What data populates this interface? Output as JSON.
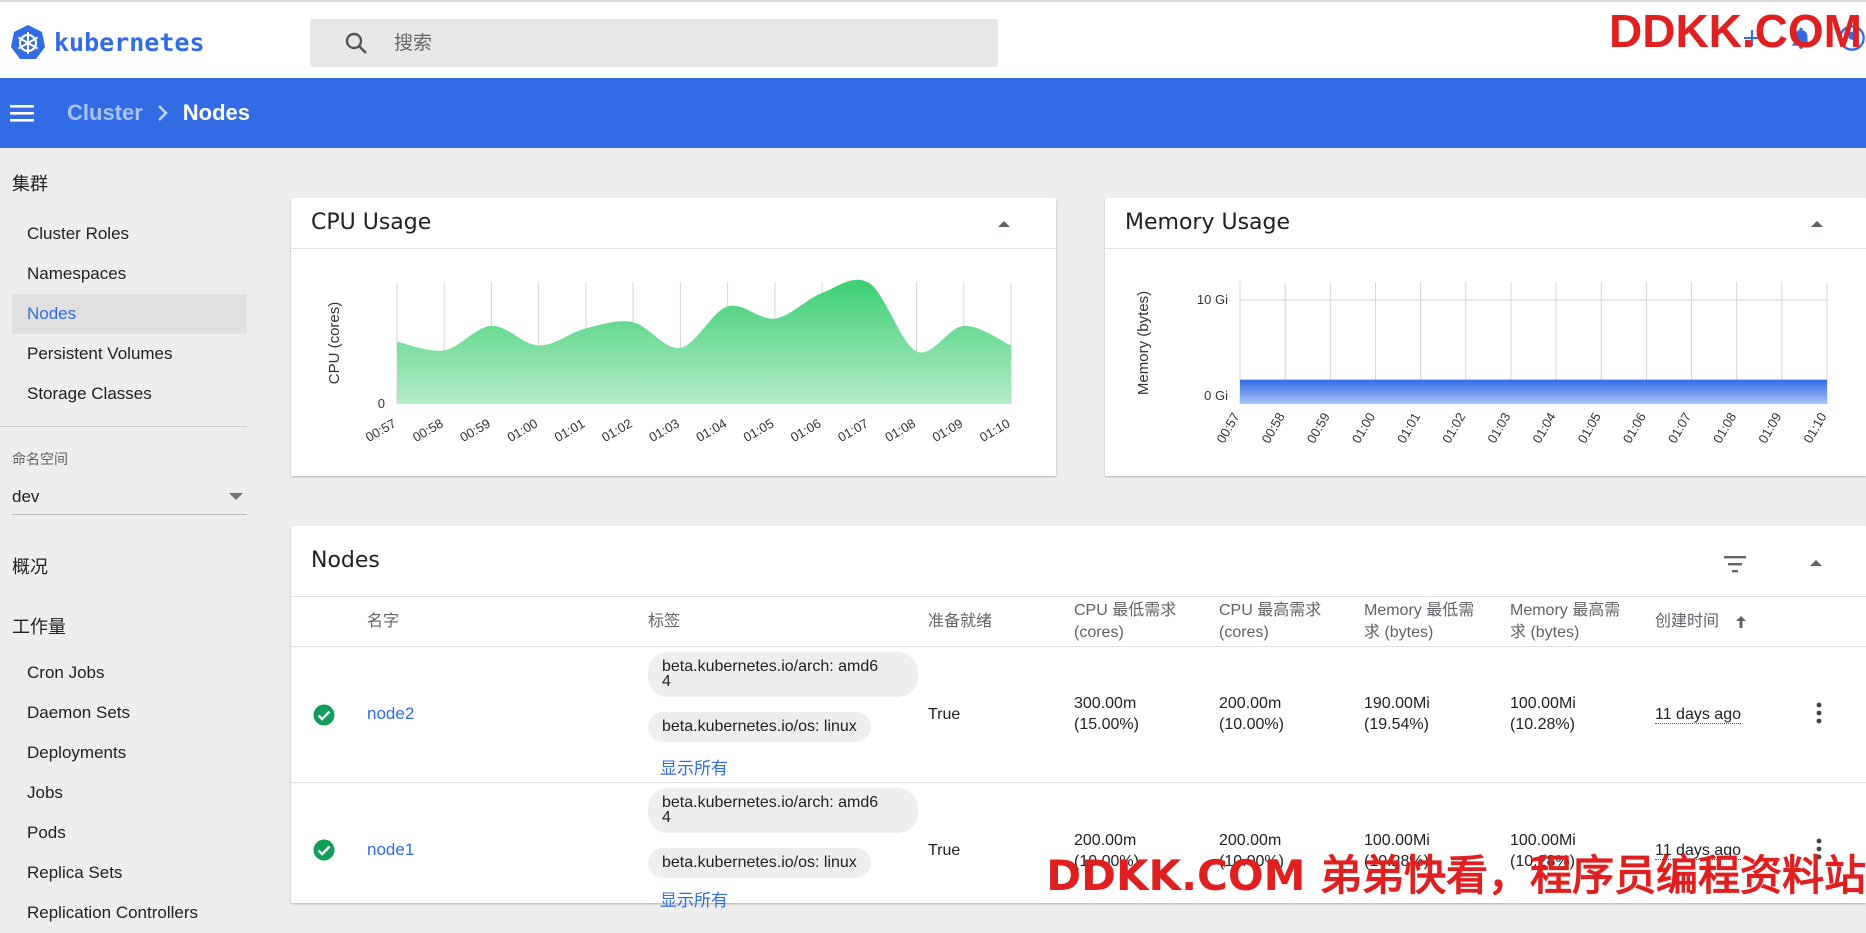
{
  "app": {
    "logo_text": "kubernetes"
  },
  "search": {
    "placeholder": "搜索"
  },
  "watermark": {
    "top": "DDKK.COM",
    "bottom": "DDKK.COM 弟弟快看，程序员编程资料站"
  },
  "breadcrumb": {
    "parent": "Cluster",
    "current": "Nodes"
  },
  "sidebar": {
    "cluster_heading": "集群",
    "cluster_items": [
      "Cluster Roles",
      "Namespaces",
      "Nodes",
      "Persistent Volumes",
      "Storage Classes"
    ],
    "namespace_label": "命名空间",
    "namespace_value": "dev",
    "overview_heading": "概况",
    "workloads_heading": "工作量",
    "workload_items": [
      "Cron Jobs",
      "Daemon Sets",
      "Deployments",
      "Jobs",
      "Pods",
      "Replica Sets",
      "Replication Controllers"
    ]
  },
  "colors": {
    "brand": "#326ce5",
    "cpu_fill": "#3ccf73",
    "mem_fill": "#326ce5",
    "ready": "#0f9d58"
  },
  "cpu_card": {
    "title": "CPU Usage"
  },
  "mem_card": {
    "title": "Memory Usage"
  },
  "chart_data": [
    {
      "type": "area",
      "title": "CPU Usage",
      "ylabel": "CPU (cores)",
      "xlabel": "",
      "y_ticks": [
        "0"
      ],
      "x": [
        "00:57",
        "00:58",
        "00:59",
        "01:00",
        "01:01",
        "01:02",
        "01:03",
        "01:04",
        "01:05",
        "01:06",
        "01:07",
        "01:08",
        "01:09",
        "01:10"
      ],
      "series": [
        {
          "values": [
            0.51,
            0.44,
            0.64,
            0.48,
            0.62,
            0.67,
            0.46,
            0.8,
            0.7,
            0.91,
            0.99,
            0.43,
            0.64,
            0.48
          ]
        }
      ],
      "ylim": [
        0,
        1
      ]
    },
    {
      "type": "area",
      "title": "Memory Usage",
      "ylabel": "Memory (bytes)",
      "xlabel": "",
      "y_ticks": [
        "10 Gi",
        "0 Gi"
      ],
      "x": [
        "00:57",
        "00:58",
        "00:59",
        "01:00",
        "01:01",
        "01:02",
        "01:03",
        "01:04",
        "01:05",
        "01:06",
        "01:07",
        "01:08",
        "01:09",
        "01:10"
      ],
      "series": [
        {
          "values": [
            2.0,
            2.0,
            2.0,
            2.0,
            2.0,
            2.0,
            2.0,
            2.0,
            2.0,
            2.0,
            2.0,
            2.0,
            2.0,
            2.0
          ]
        }
      ],
      "ylim": [
        0,
        10
      ]
    }
  ],
  "nodes": {
    "title": "Nodes",
    "headers": {
      "name": "名字",
      "labels": "标签",
      "ready": "准备就绪",
      "cpu_req_1": "CPU 最低需求",
      "cpu_req_2": "(cores)",
      "cpu_lim_1": "CPU 最高需求",
      "cpu_lim_2": "(cores)",
      "mem_req_1": "Memory 最低需",
      "mem_req_2": "求 (bytes)",
      "mem_lim_1": "Memory 最高需",
      "mem_lim_2": "求 (bytes)",
      "created": "创建时间"
    },
    "rows": [
      {
        "name": "node2",
        "label_arch_1": "beta.kubernetes.io/arch: amd6",
        "label_arch_2": "4",
        "label_os": "beta.kubernetes.io/os: linux",
        "show_all": "显示所有",
        "ready": "True",
        "cpu_req_1": "300.00m",
        "cpu_req_2": "(15.00%)",
        "cpu_lim_1": "200.00m",
        "cpu_lim_2": "(10.00%)",
        "mem_req_1": "190.00Mi",
        "mem_req_2": "(19.54%)",
        "mem_lim_1": "100.00Mi",
        "mem_lim_2": "(10.28%)",
        "created": "11 days ago"
      },
      {
        "name": "node1",
        "label_arch_1": "beta.kubernetes.io/arch: amd6",
        "label_arch_2": "4",
        "label_os": "beta.kubernetes.io/os: linux",
        "show_all": "显示所有",
        "ready": "True",
        "cpu_req_1": "200.00m",
        "cpu_req_2": "(10.00%)",
        "cpu_lim_1": "200.00m",
        "cpu_lim_2": "(10.00%)",
        "mem_req_1": "100.00Mi",
        "mem_req_2": "(10.28%)",
        "mem_lim_1": "100.00Mi",
        "mem_lim_2": "(10.28%)",
        "created": "11 days ago"
      }
    ]
  }
}
